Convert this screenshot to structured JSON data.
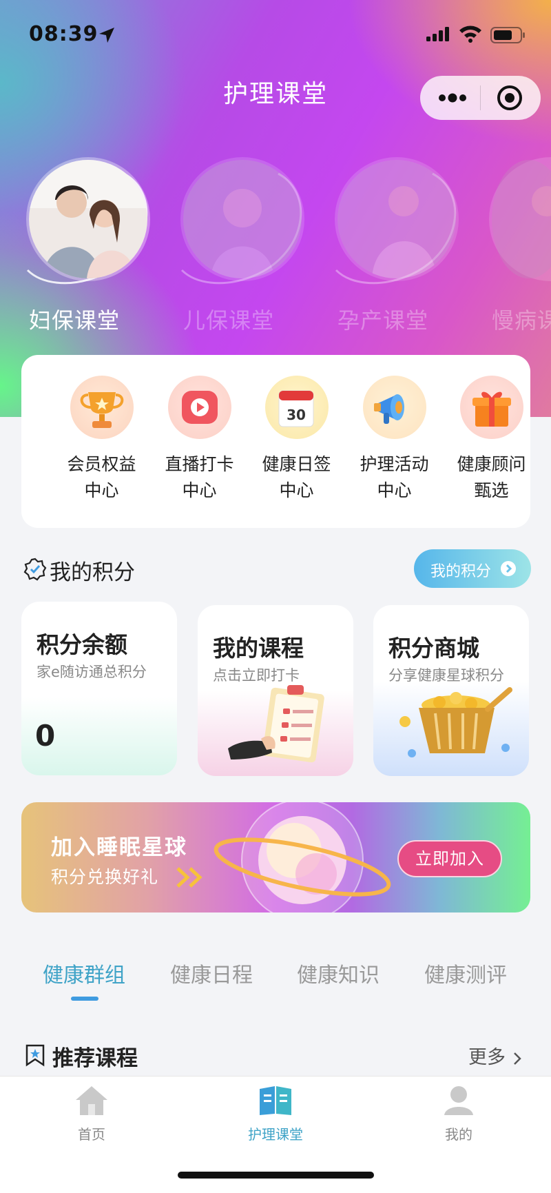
{
  "status_bar": {
    "time": "08:39",
    "icons": [
      "location-arrow-icon",
      "signal-icon",
      "wifi-icon",
      "battery-icon"
    ]
  },
  "nav": {
    "title": "护理课堂"
  },
  "categories": [
    {
      "label": "妇保课堂",
      "active": true
    },
    {
      "label": "儿保课堂",
      "active": false
    },
    {
      "label": "孕产课堂",
      "active": false
    },
    {
      "label": "慢病课堂",
      "active": false
    }
  ],
  "quick_menu": [
    {
      "line1": "会员权益",
      "line2": "中心",
      "icon": "trophy-icon"
    },
    {
      "line1": "直播打卡",
      "line2": "中心",
      "icon": "play-icon"
    },
    {
      "line1": "健康日签",
      "line2": "中心",
      "icon": "calendar-icon",
      "calendar_day": "30"
    },
    {
      "line1": "护理活动",
      "line2": "中心",
      "icon": "megaphone-icon"
    },
    {
      "line1": "健康顾问",
      "line2": "甄选",
      "icon": "gift-icon"
    }
  ],
  "points": {
    "title": "我的积分",
    "button_label": "我的积分",
    "cards": [
      {
        "title": "积分余额",
        "subtitle": "家e随访通总积分",
        "value": "0"
      },
      {
        "title": "我的课程",
        "subtitle": "点击立即打卡"
      },
      {
        "title": "积分商城",
        "subtitle": "分享健康星球积分"
      }
    ]
  },
  "banner": {
    "title": "加入睡眠星球",
    "subtitle": "积分兑换好礼",
    "button_label": "立即加入"
  },
  "tabs": [
    {
      "label": "健康群组",
      "active": true
    },
    {
      "label": "健康日程",
      "active": false
    },
    {
      "label": "健康知识",
      "active": false
    },
    {
      "label": "健康测评",
      "active": false
    }
  ],
  "recommend": {
    "title": "推荐课程",
    "more_label": "更多"
  },
  "tabbar": [
    {
      "label": "首页",
      "icon": "home-icon",
      "active": false
    },
    {
      "label": "护理课堂",
      "icon": "book-icon",
      "active": true
    },
    {
      "label": "我的",
      "icon": "user-icon",
      "active": false
    }
  ],
  "colors": {
    "accent": "#3fa3c7",
    "join_button": "#e64c84",
    "points_button": "#56b6ea"
  }
}
